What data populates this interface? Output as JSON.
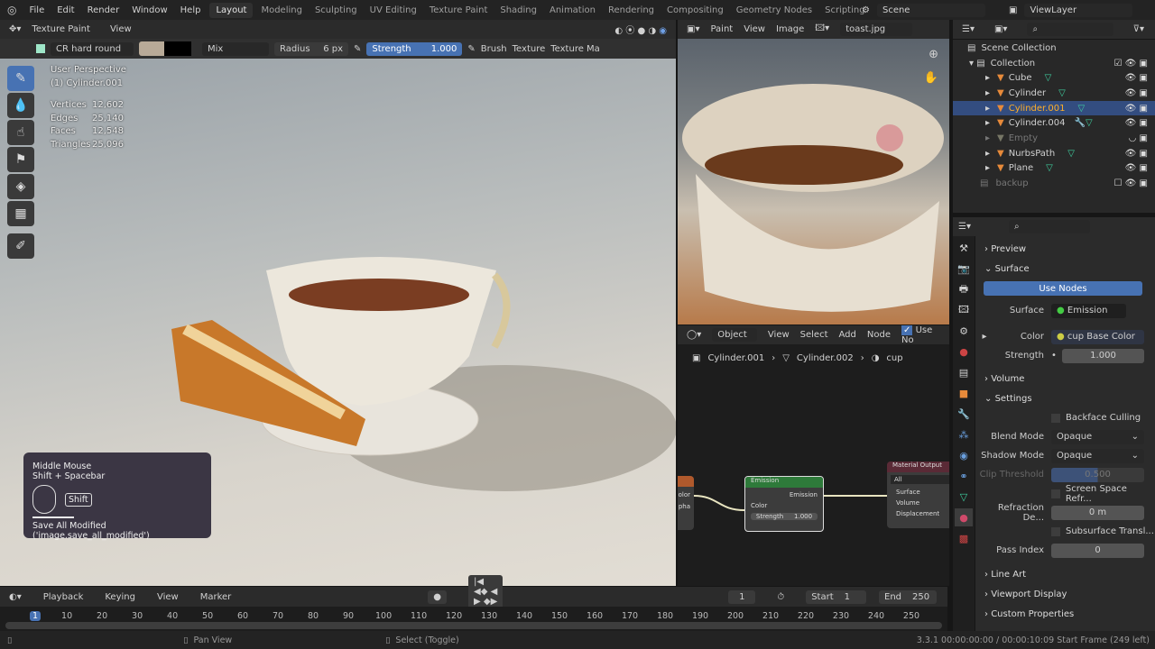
{
  "menu": {
    "items": [
      "File",
      "Edit",
      "Render",
      "Window",
      "Help"
    ],
    "workspaces": [
      "Layout",
      "Modeling",
      "Sculpting",
      "UV Editing",
      "Texture Paint",
      "Shading",
      "Animation",
      "Rendering",
      "Compositing",
      "Geometry Nodes",
      "Scripting"
    ],
    "active_workspace": "Layout",
    "add": "+",
    "scene": "Scene",
    "view_layer": "ViewLayer"
  },
  "viewport": {
    "mode": "Texture Paint",
    "view": "View",
    "brush": "CR hard round",
    "blend": "Mix",
    "radius_label": "Radius",
    "radius": "6 px",
    "strength_label": "Strength",
    "strength": "1.000",
    "brush_menu": "Brush",
    "texture_menu": "Texture",
    "texture_mask_menu": "Texture Ma",
    "overlay": {
      "perspective": "User Perspective",
      "object": "(1) Cylinder.001",
      "stats": [
        {
          "k": "Vertices",
          "v": "12,602"
        },
        {
          "k": "Edges",
          "v": "25,140"
        },
        {
          "k": "Faces",
          "v": "12,548"
        },
        {
          "k": "Triangles",
          "v": "25,096"
        }
      ]
    },
    "colors": {
      "primary": "#b8aa98",
      "secondary": "#000000",
      "accent": "#4772b3"
    }
  },
  "keytip": {
    "line1": "Middle Mouse",
    "line2": "Shift + Spacebar",
    "shift_key": "Shift",
    "operator": "Save All Modified ('image.save_all_modified')"
  },
  "image_editor": {
    "mode": "Paint",
    "view": "View",
    "image": "Image",
    "file": "toast.jpg"
  },
  "node_editor": {
    "type": "Object",
    "view": "View",
    "select": "Select",
    "add": "Add",
    "node": "Node",
    "use_nodes": "Use No",
    "breadcrumb": [
      "Cylinder.001",
      "Cylinder.002",
      "cup"
    ],
    "emission": {
      "title": "Emission",
      "out": "Emission",
      "color": "Color",
      "strength_label": "Strength",
      "strength": "1.000"
    },
    "output": {
      "title": "Material Output",
      "target": "All",
      "surface": "Surface",
      "volume": "Volume",
      "displacement": "Displacement"
    },
    "left_node": {
      "color": "olor",
      "alpha": "pha"
    }
  },
  "outliner": {
    "root": "Scene Collection",
    "collection": "Collection",
    "items": [
      {
        "name": "Cube"
      },
      {
        "name": "Cylinder"
      },
      {
        "name": "Cylinder.001",
        "selected": true
      },
      {
        "name": "Cylinder.004"
      },
      {
        "name": "Empty",
        "dim": true
      },
      {
        "name": "NurbsPath"
      },
      {
        "name": "Plane"
      }
    ],
    "backup": "backup"
  },
  "properties": {
    "preview": "Preview",
    "surface_panel": "Surface",
    "use_nodes": "Use Nodes",
    "surface_label": "Surface",
    "surface_value": "Emission",
    "color_label": "Color",
    "color_value": "cup Base Color",
    "strength_label": "Strength",
    "strength_value": "1.000",
    "volume": "Volume",
    "settings": "Settings",
    "backface": "Backface Culling",
    "blend_label": "Blend Mode",
    "blend_value": "Opaque",
    "shadow_label": "Shadow Mode",
    "shadow_value": "Opaque",
    "clip_label": "Clip Threshold",
    "clip_value": "0.500",
    "ssr": "Screen Space Refr...",
    "refr_label": "Refraction De...",
    "refr_value": "0 m",
    "sss": "Subsurface Transl...",
    "pass_label": "Pass Index",
    "pass_value": "0",
    "line_art": "Line Art",
    "viewport_display": "Viewport Display",
    "custom_props": "Custom Properties"
  },
  "timeline": {
    "playback": "Playback",
    "keying": "Keying",
    "view": "View",
    "marker": "Marker",
    "current": "1",
    "start_label": "Start",
    "start": "1",
    "end_label": "End",
    "end": "250",
    "ticks": [
      "1",
      "10",
      "20",
      "30",
      "40",
      "50",
      "60",
      "70",
      "80",
      "90",
      "100",
      "110",
      "120",
      "130",
      "140",
      "150",
      "160",
      "170",
      "180",
      "190",
      "200",
      "210",
      "220",
      "230",
      "240",
      "250"
    ]
  },
  "statusbar": {
    "pan": "Pan View",
    "select": "Select (Toggle)",
    "info": "3.3.1  00:00:00:00 / 00:00:10:09  Start Frame (249 left)"
  }
}
